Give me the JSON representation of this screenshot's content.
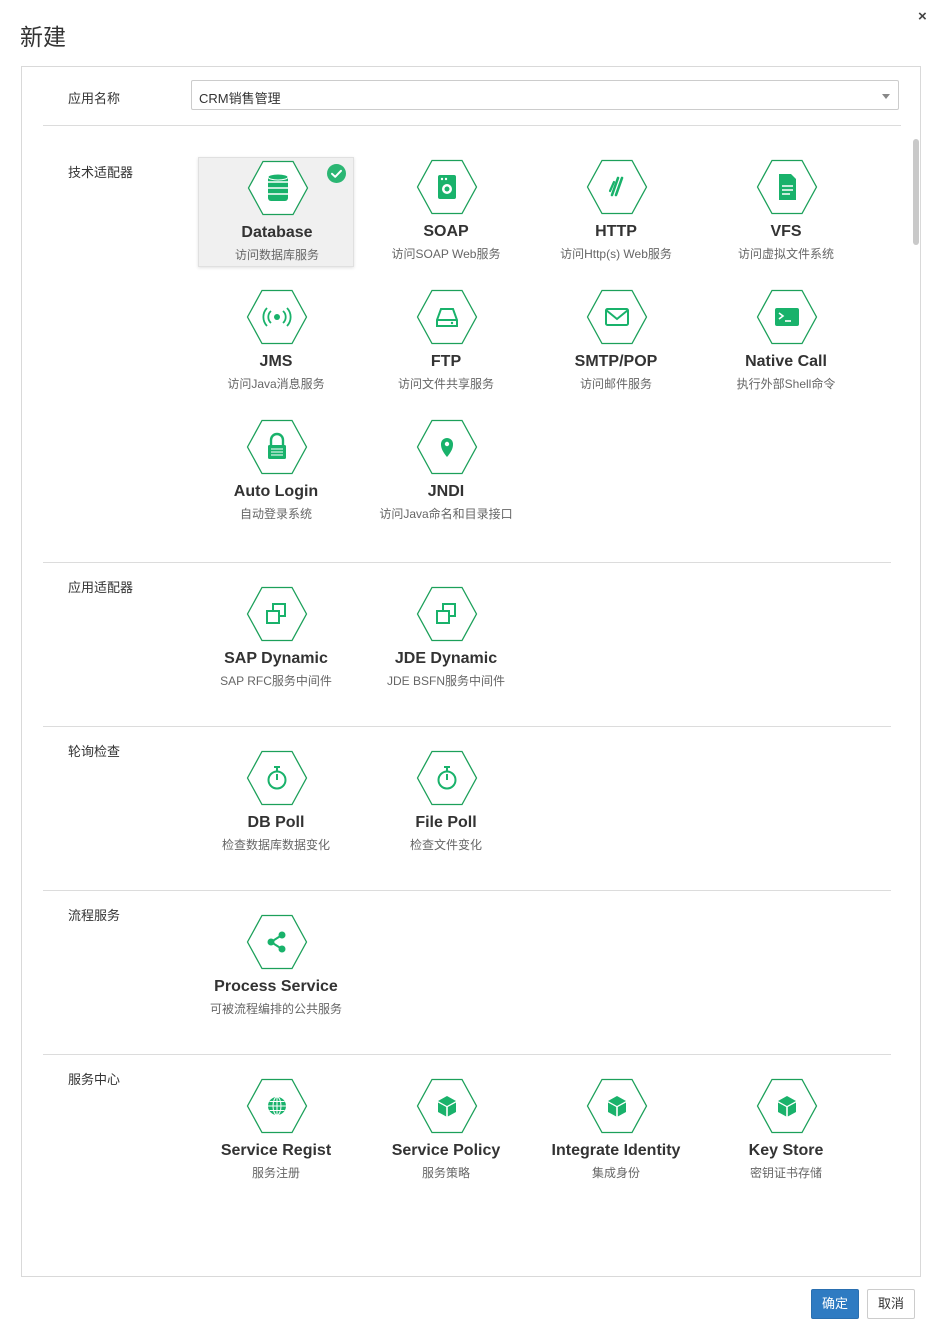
{
  "dialog": {
    "title": "新建",
    "close_label": "×",
    "app_name_label": "应用名称",
    "app_name_value": "CRM销售管理"
  },
  "sections": {
    "tech": {
      "label": "技术适配器",
      "tiles": [
        {
          "title": "Database",
          "desc": "访问数据库服务",
          "icon": "database-icon",
          "selected": true
        },
        {
          "title": "SOAP",
          "desc": "访问SOAP Web服务",
          "icon": "soap-icon"
        },
        {
          "title": "HTTP",
          "desc": "访问Http(s) Web服务",
          "icon": "http-icon"
        },
        {
          "title": "VFS",
          "desc": "访问虚拟文件系统",
          "icon": "file-icon"
        },
        {
          "title": "JMS",
          "desc": "访问Java消息服务",
          "icon": "broadcast-icon"
        },
        {
          "title": "FTP",
          "desc": "访问文件共享服务",
          "icon": "drive-icon"
        },
        {
          "title": "SMTP/POP",
          "desc": "访问邮件服务",
          "icon": "envelope-icon"
        },
        {
          "title": "Native Call",
          "desc": "执行外部Shell命令",
          "icon": "terminal-icon"
        },
        {
          "title": "Auto Login",
          "desc": "自动登录系统",
          "icon": "lock-icon"
        },
        {
          "title": "JNDI",
          "desc": "访问Java命名和目录接口",
          "icon": "map-pin-icon"
        }
      ]
    },
    "app": {
      "label": "应用适配器",
      "tiles": [
        {
          "title": "SAP Dynamic",
          "desc": "SAP RFC服务中间件",
          "icon": "windows-icon"
        },
        {
          "title": "JDE Dynamic",
          "desc": "JDE BSFN服务中间件",
          "icon": "windows-icon"
        }
      ]
    },
    "poll": {
      "label": "轮询检查",
      "tiles": [
        {
          "title": "DB Poll",
          "desc": "检查数据库数据变化",
          "icon": "stopwatch-icon"
        },
        {
          "title": "File Poll",
          "desc": "检查文件变化",
          "icon": "stopwatch-icon"
        }
      ]
    },
    "process": {
      "label": "流程服务",
      "tiles": [
        {
          "title": "Process Service",
          "desc": "可被流程编排的公共服务",
          "icon": "share-icon"
        }
      ]
    },
    "center": {
      "label": "服务中心",
      "tiles": [
        {
          "title": "Service Regist",
          "desc": "服务注册",
          "icon": "globe-icon"
        },
        {
          "title": "Service Policy",
          "desc": "服务策略",
          "icon": "cube-icon"
        },
        {
          "title": "Integrate Identity",
          "desc": "集成身份",
          "icon": "cube-icon"
        },
        {
          "title": "Key Store",
          "desc": "密钥证书存储",
          "icon": "cube-icon"
        }
      ]
    }
  },
  "footer": {
    "ok_label": "确定",
    "cancel_label": "取消"
  },
  "colors": {
    "accent_green": "#1ca05a",
    "icon_fill": "#19b26b",
    "primary_blue": "#2f7bc2"
  }
}
